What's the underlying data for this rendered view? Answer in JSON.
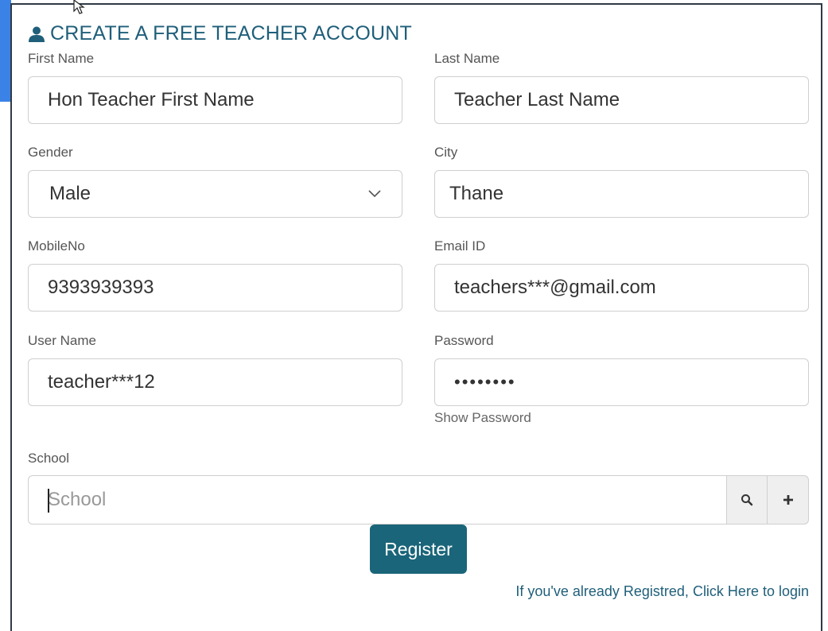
{
  "form": {
    "title": "CREATE A FREE TEACHER ACCOUNT",
    "first_name": {
      "label": "First Name",
      "value": "Hon Teacher First Name"
    },
    "last_name": {
      "label": "Last Name",
      "value": "Teacher Last Name"
    },
    "gender": {
      "label": "Gender",
      "value": "Male"
    },
    "city": {
      "label": "City",
      "value": "Thane"
    },
    "mobile": {
      "label": "MobileNo",
      "value": "9393939393"
    },
    "email": {
      "label": "Email ID",
      "value": "teachers***@gmail.com"
    },
    "username": {
      "label": "User Name",
      "value": "teacher***12"
    },
    "password": {
      "label": "Password",
      "value": "••••••••",
      "show_label": "Show Password"
    },
    "school": {
      "label": "School",
      "placeholder": "School"
    },
    "register_label": "Register",
    "login_link": "If you've already Registred, Click Here to login"
  },
  "colors": {
    "accent": "#1a6579",
    "title": "#1f5f7a",
    "background_strip": "#3b82e6"
  },
  "icons": {
    "title_icon": "user-icon",
    "search": "search-icon",
    "add": "plus-icon",
    "dropdown": "chevron-down-icon"
  }
}
